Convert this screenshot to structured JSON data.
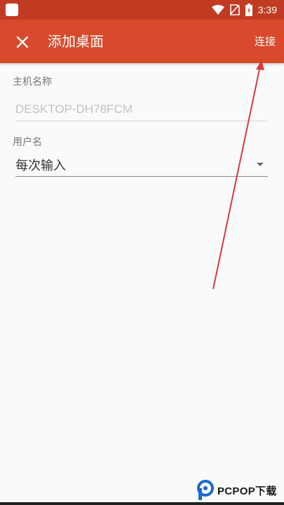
{
  "status_bar": {
    "time": "3:39",
    "icons": [
      "app-icon",
      "wifi-icon",
      "no-sim-icon",
      "battery-charging-icon"
    ]
  },
  "app_bar": {
    "close_icon": "close-icon",
    "title": "添加桌面",
    "connect_label": "连接"
  },
  "form": {
    "host_label": "主机名称",
    "host_placeholder": "DESKTOP-DH78FCM",
    "user_label": "用户名",
    "user_value": "每次输入"
  },
  "annotation": {
    "type": "arrow",
    "color": "#d93a3a",
    "points_to": "connect-button"
  },
  "watermark": {
    "text": "PCPOP下载"
  },
  "colors": {
    "app_bar": "#d84a2b",
    "status_bar": "#c13b22",
    "background": "#fafafa"
  }
}
